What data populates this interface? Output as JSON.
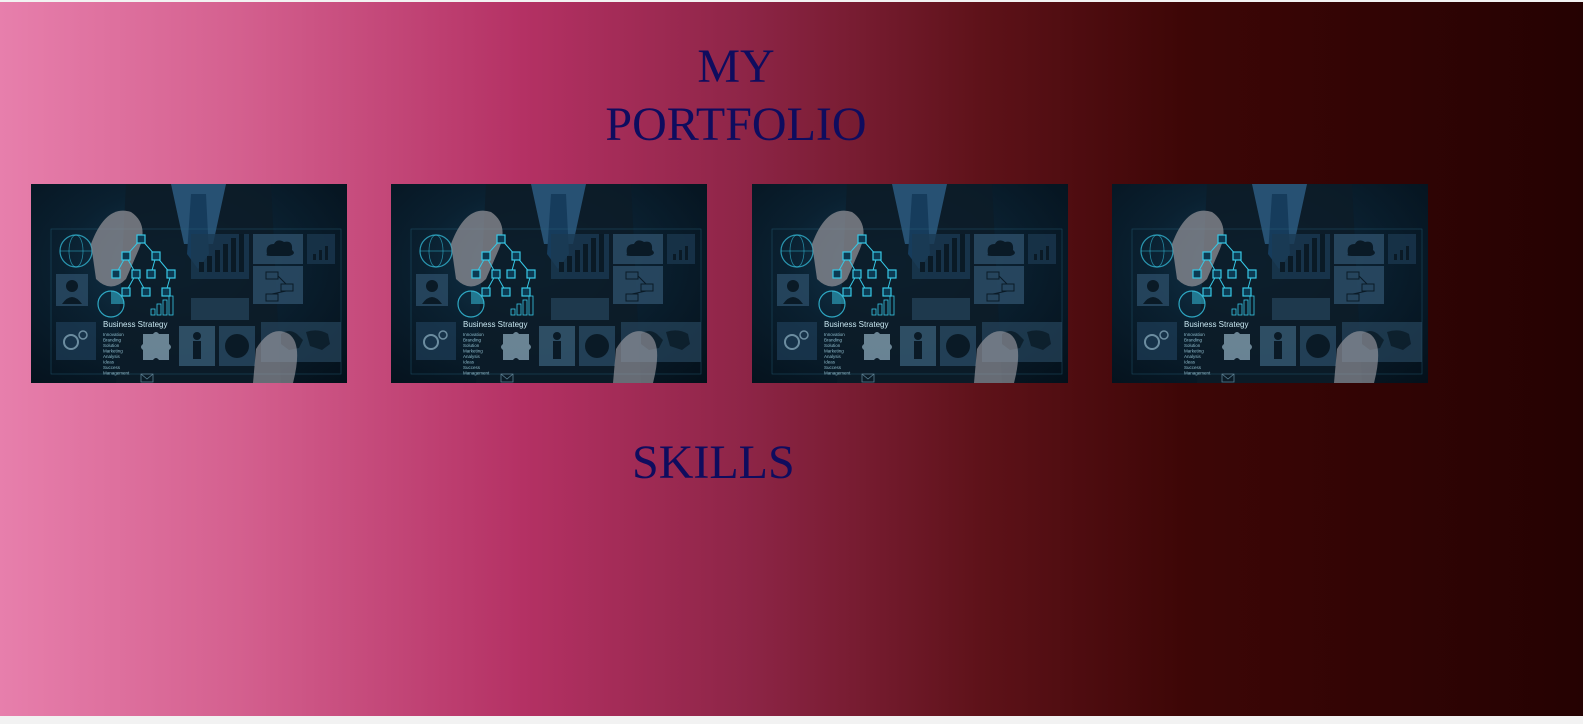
{
  "header": {
    "title_line1": "MY",
    "title_line2": "PORTFOLIO"
  },
  "portfolio": {
    "items": [
      {
        "caption": "Business Strategy",
        "list": [
          "Innovation",
          "Branding",
          "Solution",
          "Marketing",
          "Analysis",
          "Ideas",
          "Success",
          "Management"
        ]
      },
      {
        "caption": "Business Strategy",
        "list": [
          "Innovation",
          "Branding",
          "Solution",
          "Marketing",
          "Analysis",
          "Ideas",
          "Success",
          "Management"
        ]
      },
      {
        "caption": "Business Strategy",
        "list": [
          "Innovation",
          "Branding",
          "Solution",
          "Marketing",
          "Analysis",
          "Ideas",
          "Success",
          "Management"
        ]
      },
      {
        "caption": "Business Strategy",
        "list": [
          "Innovation",
          "Branding",
          "Solution",
          "Marketing",
          "Analysis",
          "Ideas",
          "Success",
          "Management"
        ]
      }
    ]
  },
  "skills": {
    "heading": "SKILLS"
  },
  "colors": {
    "heading": "#0f0c5e",
    "gradient_start": "#e77fac",
    "gradient_mid": "#b43164",
    "gradient_end": "#250202",
    "image_glow": "#37c8e6"
  }
}
